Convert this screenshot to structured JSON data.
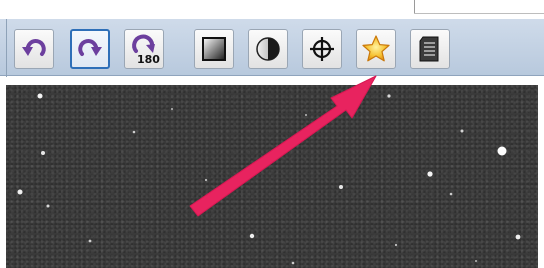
{
  "toolbar": {
    "buttons": [
      {
        "name": "rotate-left-button",
        "icon": "rotate-left-icon",
        "selected": false
      },
      {
        "name": "rotate-right-button",
        "icon": "rotate-right-icon",
        "selected": true
      },
      {
        "name": "rotate-180-button",
        "icon": "rotate-180-icon",
        "label": "180",
        "selected": false
      },
      {
        "name": "gradient-button",
        "icon": "gradient-icon",
        "selected": false
      },
      {
        "name": "contrast-button",
        "icon": "contrast-icon",
        "selected": false
      },
      {
        "name": "crosshair-button",
        "icon": "crosshair-icon",
        "selected": false
      },
      {
        "name": "star-button",
        "icon": "star-icon",
        "selected": false,
        "highlighted_by_arrow": true
      },
      {
        "name": "document-button",
        "icon": "document-icon",
        "selected": false
      }
    ]
  },
  "colors": {
    "accent": "#2e6fb8",
    "rotate_icon": "#6c3f9e",
    "annotation_arrow": "#e8235f",
    "star": "#f6b417"
  }
}
